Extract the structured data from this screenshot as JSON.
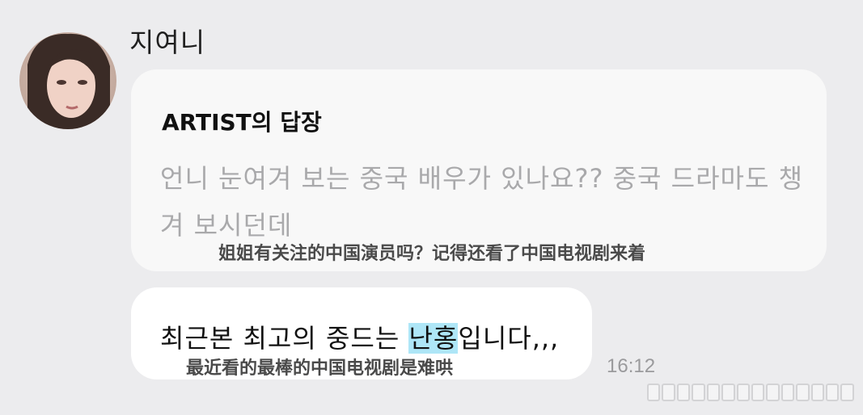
{
  "sender": {
    "name": "지여니"
  },
  "reply": {
    "heading": "ARTIST의 답장",
    "quoted_text": "언니 눈여겨 보는 중국 배우가 있나요?? 중국 드라마도 챙겨 보시던데",
    "translation": "姐姐有关注的中国演员吗？记得还看了中国电视剧来着"
  },
  "message": {
    "text_before": "최근본 최고의 중드는 ",
    "text_highlight": "난홍",
    "text_after": "입니다,,,",
    "translation": "最近看的最棒的中国电视剧是难哄",
    "highlight_color": "#aee6f7"
  },
  "timestamp": "16:12",
  "colors": {
    "background": "#ececee",
    "reply_card": "#f8f8f8",
    "message_bubble": "#ffffff",
    "quoted_text": "#a9a9ab"
  },
  "icons": {
    "avatar": "profile-photo",
    "watermark": "watermark-icon"
  }
}
